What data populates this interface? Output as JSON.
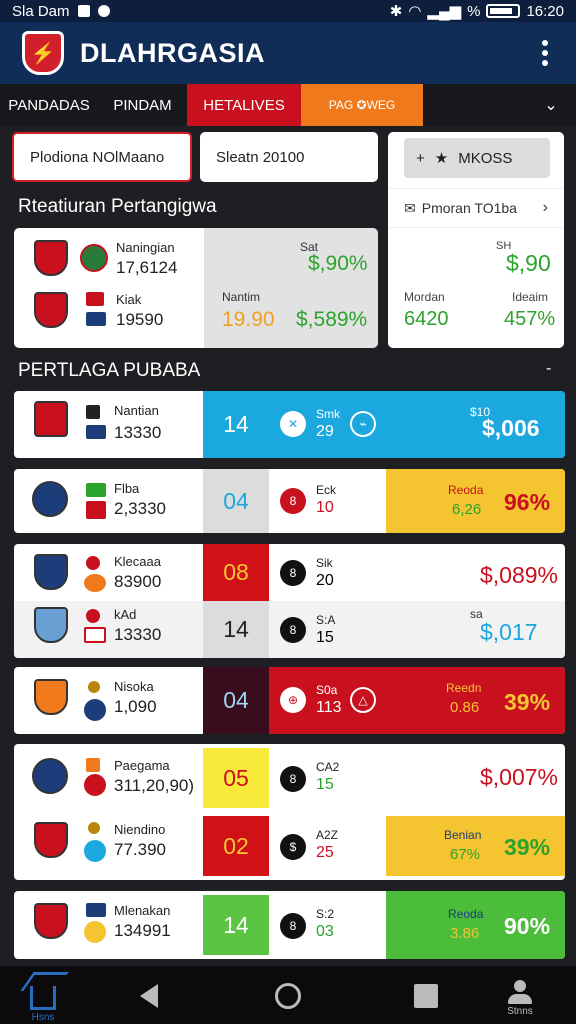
{
  "status_bar": {
    "carrier": "Sla Dam",
    "battery_pct": "%",
    "time": "16:20"
  },
  "app": {
    "logo_glyph": "⚡",
    "title": "DLAHRGASIA"
  },
  "tabs": [
    {
      "label": "PANDADAS"
    },
    {
      "label": "PINDAM"
    },
    {
      "label": "HETALIVES"
    },
    {
      "label": "PAG ✪WEG"
    }
  ],
  "filters": {
    "first": "Plodiona NOlMaano",
    "second": "Sleatn 20100"
  },
  "side_card": {
    "markets_label": "MKOSS",
    "promo_label": "Pmoran TO1ba",
    "top_small": "SH",
    "top_value": "$,90",
    "left_label": "Mordan",
    "left_value": "6420",
    "right_label": "Ideaim",
    "right_value": "457%"
  },
  "sections": {
    "featured": "Rteatiuran Pertangigwa",
    "list": "PERTLAGA PUBABA"
  },
  "featured": {
    "team1_name": "Naningian",
    "team1_num": "17,6124",
    "team2_name": "Kiak",
    "team2_num": "19590",
    "top_small": "Sat",
    "top_odds": "$,90%",
    "label": "Nantim",
    "value": "19.90",
    "odds2": "$,589%"
  },
  "rows": [
    {
      "name": "Nantian",
      "num": "13330",
      "score": "14",
      "circle": "✕",
      "mid_top": "Smk",
      "mid_bottom": "29",
      "odds_label": "$10",
      "odds": "$,006",
      "odds_sub": ""
    },
    {
      "name": "Flba",
      "num": "2,3330",
      "score": "04",
      "circle": "8",
      "mid_top": "Eck",
      "mid_bottom": "10",
      "odds_label": "Reoda",
      "odds": "96%",
      "odds_sub": "6,26"
    },
    {
      "name": "Klecaaa",
      "num": "83900",
      "score": "08",
      "circle": "8",
      "mid_top": "Sik",
      "mid_bottom": "20",
      "odds_label": "",
      "odds": "$,089%",
      "odds_sub": ""
    },
    {
      "name": "kAd",
      "num": "13330",
      "score": "14",
      "circle": "8",
      "mid_top": "S:A",
      "mid_bottom": "15",
      "odds_label": "sa",
      "odds": "$,017",
      "odds_sub": ""
    },
    {
      "name": "Nisoka",
      "num": "1,090",
      "score": "04",
      "circle": "⊕",
      "mid_top": "S0a",
      "mid_bottom": "113",
      "odds_label": "Reedn",
      "odds": "39%",
      "odds_sub": "0.86"
    },
    {
      "name": "Paegama",
      "num": "311,20,90)",
      "score": "05",
      "circle": "8",
      "mid_top": "CA2",
      "mid_bottom": "15",
      "odds_label": "",
      "odds": "$,007%",
      "odds_sub": ""
    },
    {
      "name": "Niendino",
      "num": "77.390",
      "score": "02",
      "circle": "$",
      "mid_top": "A2Z",
      "mid_bottom": "25",
      "odds_label": "Benian",
      "odds": "39%",
      "odds_sub": "67%"
    },
    {
      "name": "Mlenakan",
      "num": "134991",
      "score": "14",
      "circle": "8",
      "mid_top": "S:2",
      "mid_bottom": "03",
      "odds_label": "Reoda",
      "odds": "90%",
      "odds_sub": "3.86"
    }
  ],
  "bottom_nav": {
    "home": "Hsns",
    "stats": "Stnns"
  },
  "colors": {
    "brand_blue": "#102d57",
    "red": "#c9101e",
    "orange": "#f07a1b",
    "green": "#2ca32c",
    "cyan": "#1aa8df",
    "yellow": "#f4c431"
  }
}
